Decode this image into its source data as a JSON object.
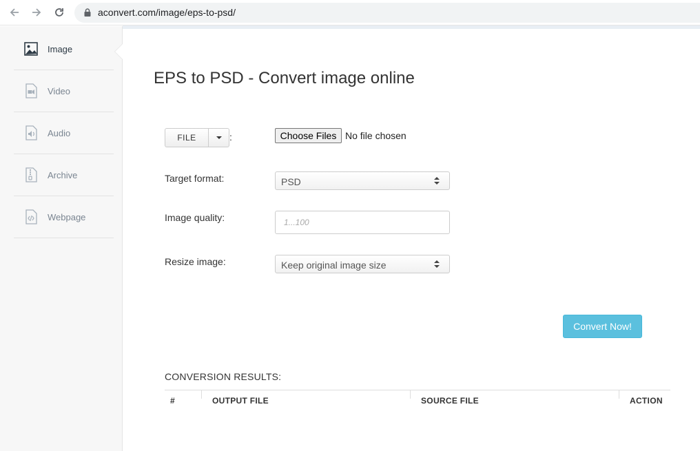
{
  "browser": {
    "url": "aconvert.com/image/eps-to-psd/"
  },
  "sidebar": {
    "items": [
      {
        "label": "Image",
        "icon": "image-icon",
        "active": true
      },
      {
        "label": "Video",
        "icon": "video-icon",
        "active": false
      },
      {
        "label": "Audio",
        "icon": "audio-icon",
        "active": false
      },
      {
        "label": "Archive",
        "icon": "archive-icon",
        "active": false
      },
      {
        "label": "Webpage",
        "icon": "webpage-icon",
        "active": false
      }
    ]
  },
  "main": {
    "title": "EPS to PSD - Convert image online",
    "file_button_label": "FILE",
    "colon": ":",
    "choose_files_label": "Choose Files",
    "no_file_text": "No file chosen",
    "target_format_label": "Target format:",
    "target_format_value": "PSD",
    "image_quality_label": "Image quality:",
    "image_quality_placeholder": "1...100",
    "resize_label": "Resize image:",
    "resize_value": "Keep original image size",
    "convert_button_label": "Convert Now!",
    "results_title": "CONVERSION RESULTS:",
    "results_columns": [
      "#",
      "OUTPUT FILE",
      "SOURCE FILE",
      "ACTION"
    ]
  },
  "colors": {
    "convert_button": "#5bc0de",
    "sidebar_bg": "#f7f7f7"
  }
}
